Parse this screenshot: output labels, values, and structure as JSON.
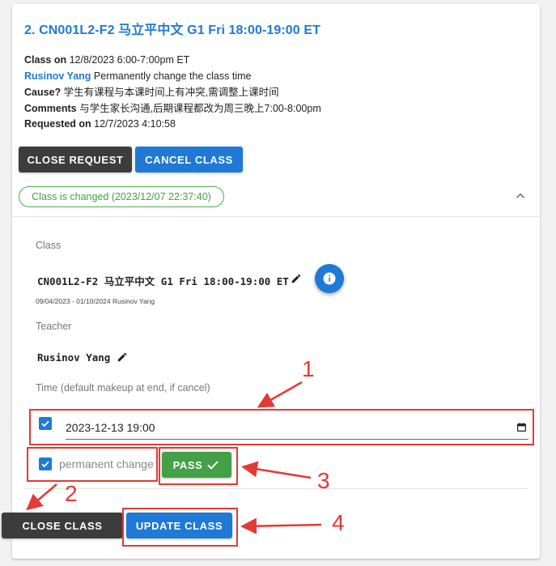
{
  "request": {
    "title": "2. CN001L2-F2 马立平中文 G1 Fri 18:00-19:00 ET",
    "class_on_label": "Class on",
    "class_on_value": "12/8/2023 6:00-7:00pm ET",
    "requester_name": "Rusinov Yang",
    "requester_action": "Permanently change the class time",
    "cause_label": "Cause?",
    "cause_value": "学生有课程与本课时间上有冲突,需调整上课时间",
    "comments_label": "Comments",
    "comments_value": "与学生家长沟通,后期课程都改为周三晚上7:00-8:00pm",
    "requested_on_label": "Requested on",
    "requested_on_value": "12/7/2023 4:10:58"
  },
  "actions": {
    "close_request": "CLOSE REQUEST",
    "cancel_class": "CANCEL CLASS"
  },
  "status_chip": "Class is changed (2023/12/07 22:37:40)",
  "details": {
    "class_label": "Class",
    "class_value": "CN001L2-F2 马立平中文 G1 Fri 18:00-19:00 ET",
    "class_range": "09/04/2023 - 01/10/2024 Rusinov Yang",
    "teacher_label": "Teacher",
    "teacher_value": "Rusinov Yang",
    "time_label": "Time (default makeup at end, if cancel)",
    "datetime_value": "2023-12-13 19:00",
    "permanent_label": "permanent change",
    "pass_label": "PASS"
  },
  "footer": {
    "close_class": "CLOSE CLASS",
    "update_class": "UPDATE CLASS"
  },
  "annotations": [
    "1",
    "2",
    "3",
    "4"
  ],
  "colors": {
    "accent": "#1e7ad6",
    "success": "#43a047",
    "dark_button": "#3c3c3c",
    "annotation_red": "#e53935"
  },
  "icons": [
    "pencil-icon",
    "info-icon",
    "checkmark-icon",
    "chevron-up-icon",
    "calendar-icon"
  ]
}
